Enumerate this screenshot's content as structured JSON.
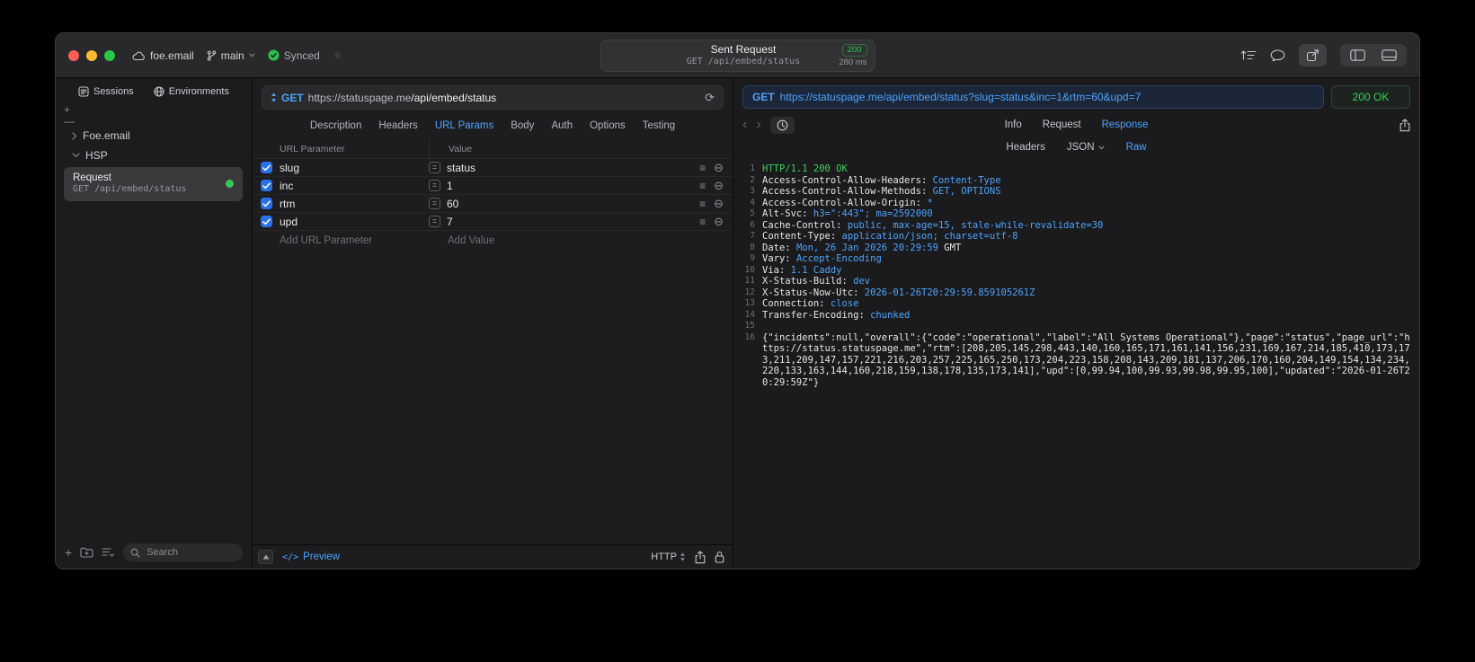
{
  "titlebar": {
    "project": "foe.email",
    "branch": "main",
    "sync": "Synced",
    "request_pill": {
      "title": "Sent Request",
      "subtitle": "GET /api/embed/status",
      "status": "200",
      "duration": "280 ms"
    }
  },
  "sidebar": {
    "tabs": [
      "Sessions",
      "Environments"
    ],
    "tree": {
      "group_collapsed": "Foe.email",
      "group_expanded": "HSP",
      "request": {
        "title": "Request",
        "subtitle": "GET /api/embed/status"
      }
    },
    "search_placeholder": "Search"
  },
  "request_pane": {
    "method": "GET",
    "url_domain": "https://statuspage.me",
    "url_path": "/api/embed/status",
    "tabs": [
      "Description",
      "Headers",
      "URL Params",
      "Body",
      "Auth",
      "Options",
      "Testing"
    ],
    "active_tab": "URL Params",
    "table": {
      "col_param": "URL Parameter",
      "col_value": "Value",
      "rows": [
        {
          "name": "slug",
          "value": "status",
          "enabled": true
        },
        {
          "name": "inc",
          "value": "1",
          "enabled": true
        },
        {
          "name": "rtm",
          "value": "60",
          "enabled": true
        },
        {
          "name": "upd",
          "value": "7",
          "enabled": true
        }
      ],
      "add_param_placeholder": "Add URL Parameter",
      "add_value_placeholder": "Add Value"
    },
    "footer": {
      "preview": "Preview",
      "code_glyph": "</>",
      "http": "HTTP"
    }
  },
  "response_pane": {
    "method": "GET",
    "url": "https://statuspage.me/api/embed/status?slug=status&inc=1&rtm=60&upd=7",
    "status": "200 OK",
    "tabs": [
      "Info",
      "Request",
      "Response"
    ],
    "active_tab": "Response",
    "subtabs": [
      "Headers",
      "JSON",
      "Raw"
    ],
    "active_subtab": "Raw",
    "lines": [
      {
        "n": "1",
        "parts": [
          {
            "t": "HTTP/1.1 200 OK",
            "c": "s"
          }
        ]
      },
      {
        "n": "2",
        "parts": [
          {
            "t": "Access-Control-Allow-Headers: ",
            "c": "n"
          },
          {
            "t": "Content-Type",
            "c": "v"
          }
        ]
      },
      {
        "n": "3",
        "parts": [
          {
            "t": "Access-Control-Allow-Methods: ",
            "c": "n"
          },
          {
            "t": "GET, OPTIONS",
            "c": "v"
          }
        ]
      },
      {
        "n": "4",
        "parts": [
          {
            "t": "Access-Control-Allow-Origin: ",
            "c": "n"
          },
          {
            "t": "*",
            "c": "v"
          }
        ]
      },
      {
        "n": "5",
        "parts": [
          {
            "t": "Alt-Svc: ",
            "c": "n"
          },
          {
            "t": "h3=\":443\"; ma=2592000",
            "c": "v"
          }
        ]
      },
      {
        "n": "6",
        "parts": [
          {
            "t": "Cache-Control: ",
            "c": "n"
          },
          {
            "t": "public, max-age=15, stale-while-revalidate=30",
            "c": "v"
          }
        ]
      },
      {
        "n": "7",
        "parts": [
          {
            "t": "Content-Type: ",
            "c": "n"
          },
          {
            "t": "application/json; charset=utf-8",
            "c": "v"
          }
        ]
      },
      {
        "n": "8",
        "parts": [
          {
            "t": "Date: ",
            "c": "n"
          },
          {
            "t": "Mon, 26 Jan 2026 20:29:59",
            "c": "v"
          },
          {
            "t": " GMT",
            "c": "n"
          }
        ]
      },
      {
        "n": "9",
        "parts": [
          {
            "t": "Vary: ",
            "c": "n"
          },
          {
            "t": "Accept-Encoding",
            "c": "v"
          }
        ]
      },
      {
        "n": "10",
        "parts": [
          {
            "t": "Via: ",
            "c": "n"
          },
          {
            "t": "1.1 Caddy",
            "c": "v"
          }
        ]
      },
      {
        "n": "11",
        "parts": [
          {
            "t": "X-Status-Build: ",
            "c": "n"
          },
          {
            "t": "dev",
            "c": "v"
          }
        ]
      },
      {
        "n": "12",
        "parts": [
          {
            "t": "X-Status-Now-Utc: ",
            "c": "n"
          },
          {
            "t": "2026-01-26T20:29:59.859105261Z",
            "c": "v"
          }
        ]
      },
      {
        "n": "13",
        "parts": [
          {
            "t": "Connection: ",
            "c": "n"
          },
          {
            "t": "close",
            "c": "v"
          }
        ]
      },
      {
        "n": "14",
        "parts": [
          {
            "t": "Transfer-Encoding: ",
            "c": "n"
          },
          {
            "t": "chunked",
            "c": "v"
          }
        ]
      },
      {
        "n": "15",
        "parts": []
      },
      {
        "n": "16",
        "parts": [
          {
            "t": "{\"incidents\":null,\"overall\":{\"code\":\"operational\",\"label\":\"All Systems Operational\"},\"page\":\"status\",\"page_url\":\"https://status.statuspage.me\",\"rtm\":[208,205,145,298,443,140,160,165,171,161,141,156,231,169,167,214,185,410,173,173,211,209,147,157,221,216,203,257,225,165,250,173,204,223,158,208,143,209,181,137,206,170,160,204,149,154,134,234,220,133,163,144,160,218,159,138,178,135,173,141],\"upd\":[0,99.94,100,99.93,99.98,99.95,100],\"updated\":\"2026-01-26T20:29:59Z\"}",
            "c": "b"
          }
        ]
      }
    ]
  },
  "colors": {
    "accent_blue": "#4da3ff",
    "success_green": "#30d158",
    "status_badge_green": "#36c252",
    "checkbox_blue": "#2970ef",
    "traffic_red": "#ff5f57",
    "traffic_yellow": "#febc2e",
    "traffic_green": "#28c840"
  }
}
